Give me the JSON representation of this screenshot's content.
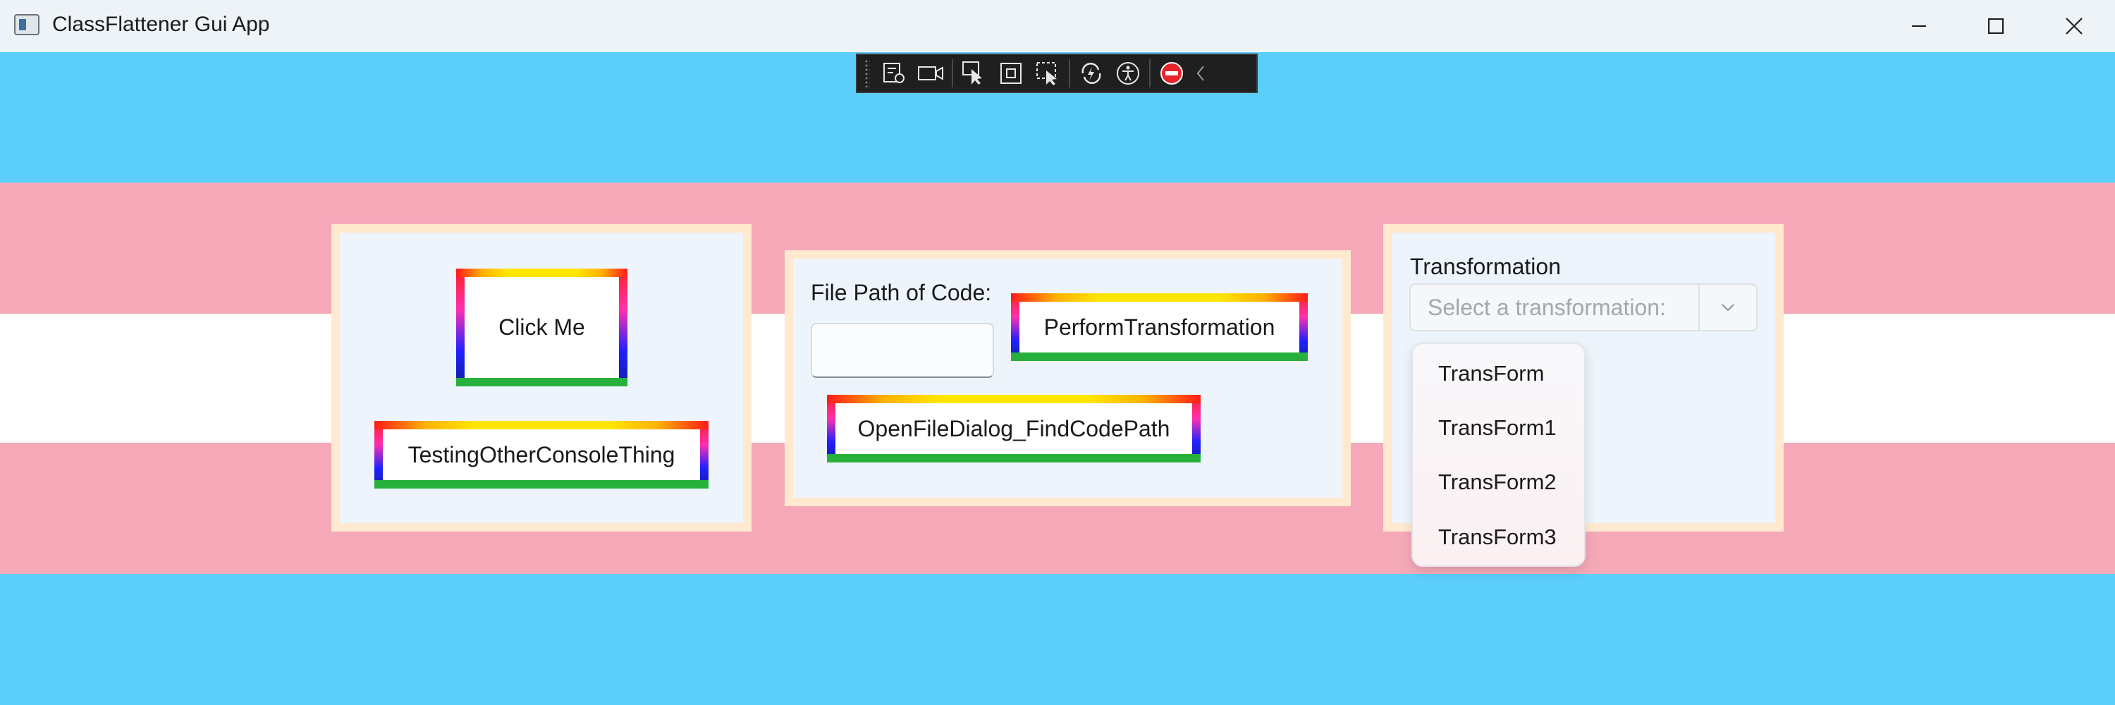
{
  "window": {
    "title": "ClassFlattener Gui App"
  },
  "panel_left": {
    "click_me_label": "Click Me",
    "testing_label": "TestingOtherConsoleThing"
  },
  "panel_middle": {
    "file_path_label": "File Path of Code:",
    "file_path_value": "",
    "perform_label": "PerformTransformation",
    "open_file_label": "OpenFileDialog_FindCodePath"
  },
  "panel_right": {
    "transformation_label": "Transformation",
    "combo_placeholder": "Select a transformation:",
    "options": [
      "TransForm",
      "TransForm1",
      "TransForm2",
      "TransForm3"
    ]
  },
  "colors": {
    "flag_blue": "#5bcefa",
    "flag_pink": "#f5a9b8",
    "flag_white": "#ffffff",
    "panel_border": "#ffe9cf"
  }
}
